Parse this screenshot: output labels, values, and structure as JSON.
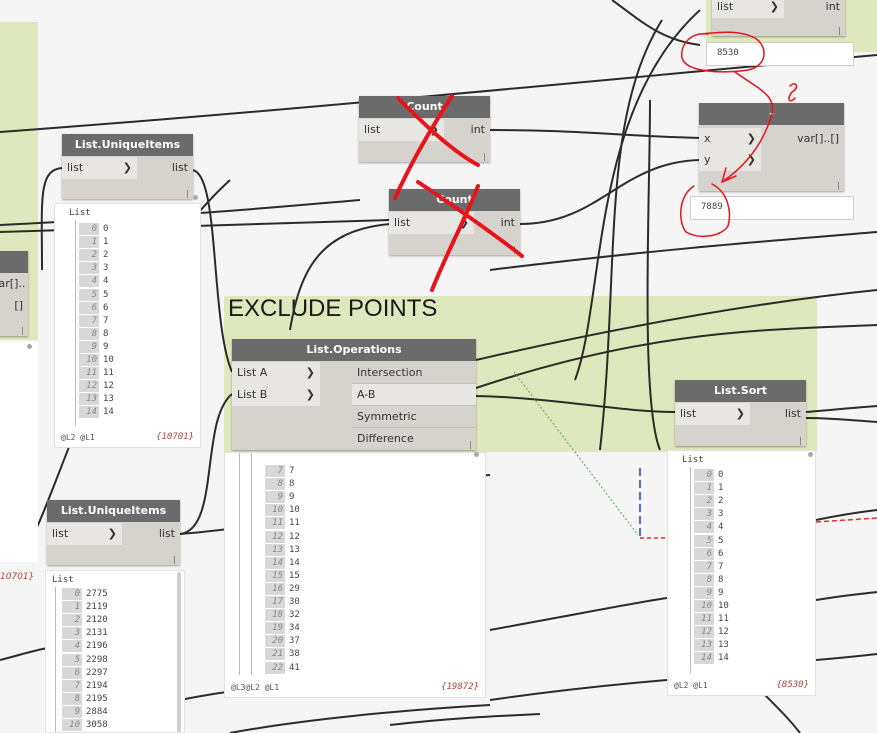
{
  "group": {
    "title": "EXCLUDE POINTS"
  },
  "nodes": {
    "count_top": {
      "title": "Count",
      "in": "list",
      "out": "int"
    },
    "count_bottom": {
      "title": "Count",
      "in": "list",
      "out": "int"
    },
    "unique_top": {
      "title": "List.UniqueItems",
      "in": "list",
      "out": "list"
    },
    "unique_bottom": {
      "title": "List.UniqueItems",
      "in": "list",
      "out": "list"
    },
    "subtract": {
      "title": "-",
      "in_x": "x",
      "in_y": "y",
      "out": "var[]..[]"
    },
    "topright": {
      "in": "list",
      "out": "int"
    },
    "leftedge": {
      "out": "var[]..[]"
    },
    "operations": {
      "title": "List.Operations",
      "in_a": "List A",
      "in_b": "List B",
      "options": [
        "Intersection",
        "A-B",
        "Symmetric Difference"
      ]
    },
    "sort": {
      "title": "List.Sort",
      "in": "list",
      "out": "list"
    }
  },
  "watch": {
    "top": "8530",
    "sub": "7889"
  },
  "previews": {
    "unique_top": {
      "header": "List",
      "levels": "@L2 @L1",
      "count": "{10701}",
      "rows": [
        [
          "0",
          "0"
        ],
        [
          "1",
          "1"
        ],
        [
          "2",
          "2"
        ],
        [
          "3",
          "3"
        ],
        [
          "4",
          "4"
        ],
        [
          "5",
          "5"
        ],
        [
          "6",
          "6"
        ],
        [
          "7",
          "7"
        ],
        [
          "8",
          "8"
        ],
        [
          "9",
          "9"
        ],
        [
          "10",
          "10"
        ],
        [
          "11",
          "11"
        ],
        [
          "12",
          "12"
        ],
        [
          "13",
          "13"
        ],
        [
          "14",
          "14"
        ]
      ]
    },
    "unique_bottom": {
      "header": "List",
      "left_count": "10701}",
      "rows": [
        [
          "0",
          "2775"
        ],
        [
          "1",
          "2119"
        ],
        [
          "2",
          "2120"
        ],
        [
          "3",
          "2131"
        ],
        [
          "4",
          "2196"
        ],
        [
          "5",
          "2298"
        ],
        [
          "6",
          "2297"
        ],
        [
          "7",
          "2194"
        ],
        [
          "8",
          "2195"
        ],
        [
          "9",
          "2884"
        ],
        [
          "10",
          "3058"
        ]
      ]
    },
    "operations": {
      "levels": "@L3@L2 @L1",
      "count": "{19872}",
      "rows": [
        [
          "7",
          "7"
        ],
        [
          "8",
          "8"
        ],
        [
          "9",
          "9"
        ],
        [
          "10",
          "10"
        ],
        [
          "11",
          "11"
        ],
        [
          "12",
          "12"
        ],
        [
          "13",
          "13"
        ],
        [
          "14",
          "14"
        ],
        [
          "15",
          "15"
        ],
        [
          "16",
          "29"
        ],
        [
          "17",
          "30"
        ],
        [
          "18",
          "32"
        ],
        [
          "19",
          "34"
        ],
        [
          "20",
          "37"
        ],
        [
          "21",
          "38"
        ],
        [
          "22",
          "41"
        ]
      ]
    },
    "sort": {
      "header": "List",
      "levels": "@L2 @L1",
      "count": "{8530}",
      "rows": [
        [
          "0",
          "0"
        ],
        [
          "1",
          "1"
        ],
        [
          "2",
          "2"
        ],
        [
          "3",
          "3"
        ],
        [
          "4",
          "4"
        ],
        [
          "5",
          "5"
        ],
        [
          "6",
          "6"
        ],
        [
          "7",
          "7"
        ],
        [
          "8",
          "8"
        ],
        [
          "9",
          "9"
        ],
        [
          "10",
          "10"
        ],
        [
          "11",
          "11"
        ],
        [
          "12",
          "12"
        ],
        [
          "13",
          "13"
        ],
        [
          "14",
          "14"
        ]
      ]
    }
  },
  "colors": {
    "group": "#dfe8bd",
    "node_header": "#6b6b6b",
    "node_body": "#d6d3cf",
    "wire": "#2b2b2b",
    "annotation": "#e8141b"
  }
}
